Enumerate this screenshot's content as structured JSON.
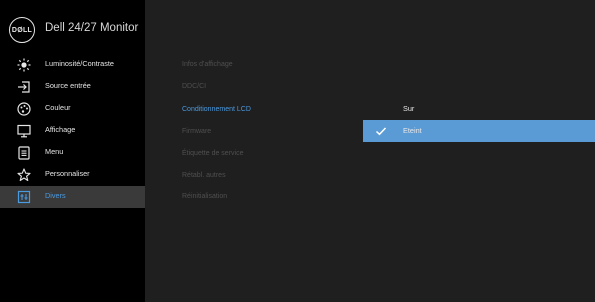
{
  "header": {
    "logo_text": "DØLL",
    "title": "Dell 24/27 Monitor"
  },
  "menu": {
    "items": [
      {
        "label": "Luminosité/Contraste",
        "icon": "brightness-icon"
      },
      {
        "label": "Source entrée",
        "icon": "input-source-icon"
      },
      {
        "label": "Couleur",
        "icon": "color-palette-icon"
      },
      {
        "label": "Affichage",
        "icon": "display-icon"
      },
      {
        "label": "Menu",
        "icon": "menu-icon"
      },
      {
        "label": "Personnaliser",
        "icon": "star-icon"
      },
      {
        "label": "Divers",
        "icon": "others-icon",
        "selected": true
      }
    ]
  },
  "submenu": {
    "items": [
      {
        "label": "Infos d'affichage"
      },
      {
        "label": "DDC/CI"
      },
      {
        "label": "Conditionnement LCD",
        "active": true
      },
      {
        "label": "Firmware"
      },
      {
        "label": "Étiquette de service"
      },
      {
        "label": "Rétabl. autres"
      },
      {
        "label": "Réinitialisation"
      }
    ]
  },
  "options": {
    "items": [
      {
        "label": "Sur"
      },
      {
        "label": "Eteint",
        "selected": true
      }
    ]
  },
  "colors": {
    "accent": "#4a9ae0",
    "selected_option_bg": "#5b9bd5",
    "left_panel_bg": "#000000",
    "panel_bg": "#1f1f1f",
    "selected_menu_bg": "#3a3a3a"
  }
}
